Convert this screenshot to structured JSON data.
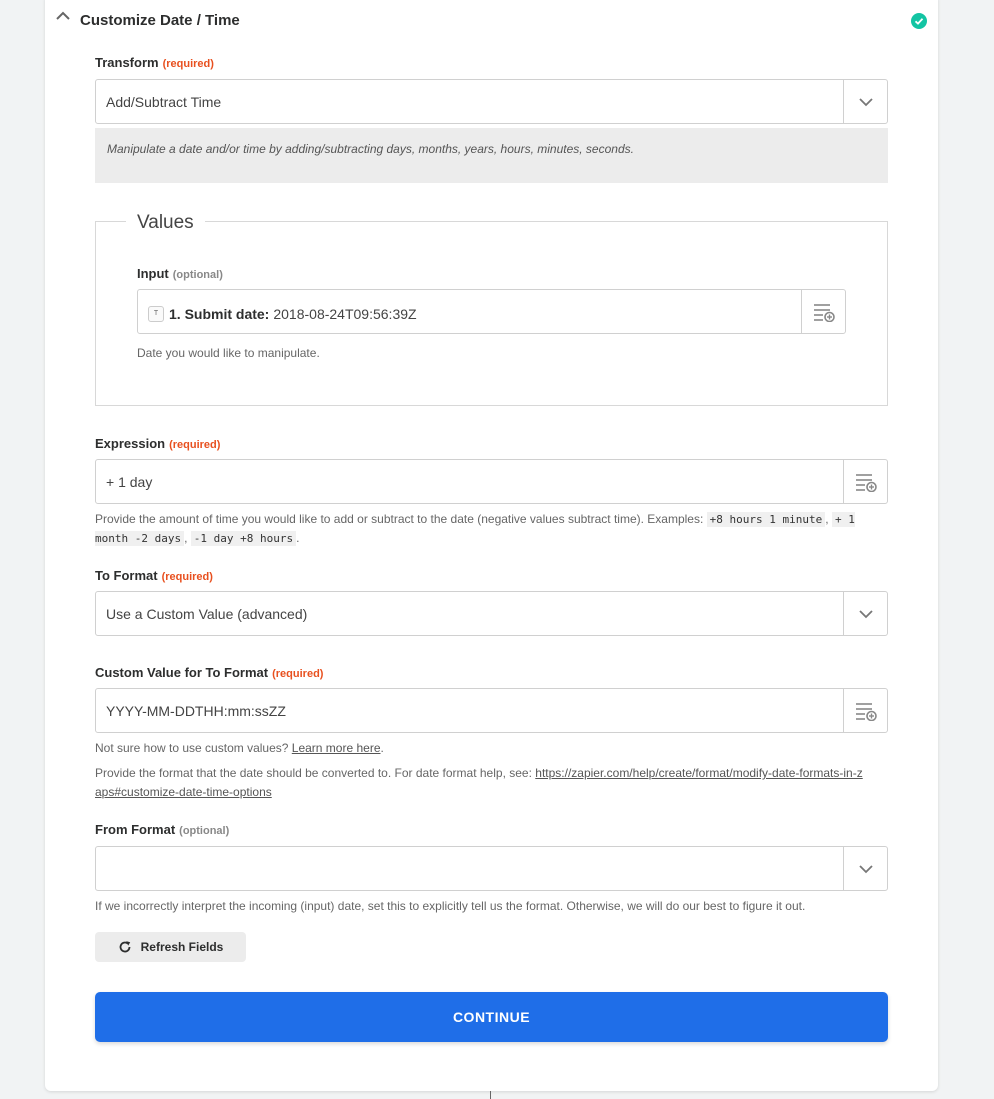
{
  "header": {
    "title": "Customize Date / Time"
  },
  "transform": {
    "label": "Transform",
    "required": "(required)",
    "value": "Add/Subtract Time",
    "description": "Manipulate a date and/or time by adding/subtracting days, months, years, hours, minutes, seconds."
  },
  "values_group": {
    "legend": "Values",
    "input": {
      "label": "Input",
      "optional": "(optional)",
      "pill_icon": "T",
      "pill_label": "1. Submit date:",
      "pill_value": "2018-08-24T09:56:39Z",
      "help": "Date you would like to manipulate."
    }
  },
  "expression": {
    "label": "Expression",
    "required": "(required)",
    "value": "+ 1 day",
    "help_prefix": "Provide the amount of time you would like to add or subtract to the date (negative values subtract time). Examples:",
    "example1": "+8 hours 1 minute",
    "example2": "+ 1 month -2 days",
    "example3": "-1 day +8 hours",
    "sep1": ",",
    "sep2": ",",
    "end": "."
  },
  "to_format": {
    "label": "To Format",
    "required": "(required)",
    "value": "Use a Custom Value (advanced)"
  },
  "custom_value": {
    "label": "Custom Value for To Format",
    "required": "(required)",
    "value": "YYYY-MM-DDTHH:mm:ssZZ",
    "help1_prefix": "Not sure how to use custom values?",
    "help1_link": "Learn more here",
    "help1_end": ".",
    "help2_prefix": "Provide the format that the date should be converted to. For date format help, see:",
    "help2_link": "https://zapier.com/help/create/format/modify-date-formats-in-zaps#customize-date-time-options"
  },
  "from_format": {
    "label": "From Format",
    "optional": "(optional)",
    "value": "",
    "help": "If we incorrectly interpret the incoming (input) date, set this to explicitly tell us the format. Otherwise, we will do our best to figure it out."
  },
  "buttons": {
    "refresh": "Refresh Fields",
    "continue": "CONTINUE"
  },
  "colors": {
    "accent": "#1f6ee8",
    "required": "#e8501f",
    "success": "#13c4a3"
  }
}
